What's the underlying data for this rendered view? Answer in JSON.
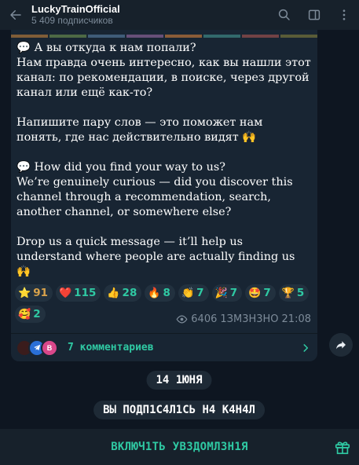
{
  "header": {
    "title": "LuckyTrainOfficial",
    "subtitle": "5 409 подписчиков",
    "icons": [
      "back-arrow-icon",
      "search-icon",
      "sidebar-toggle-icon",
      "more-vertical-icon"
    ]
  },
  "post": {
    "text": "💬 А вы откуда к нам попали?\nНам правда очень интересно, как вы нашли этот канал: по рекомендации, в поиске, через другой канал или ещё как-то?\n\nНапишите пару слов — это поможет нам понять, где нас действительно видят 🙌\n\n💬 How did you find your way to us?\nWe’re genuinely curious — did you discover this channel through a recommendation, search, another channel, or somewhere else?\n\nDrop us a quick message — it’ll help us understand where people are actually finding us 🙌",
    "reactions": [
      {
        "emoji": "⭐",
        "count": "91",
        "accent": "#d8a24b"
      },
      {
        "emoji": "❤️",
        "count": "115",
        "accent": "#2fc9a3"
      },
      {
        "emoji": "👍",
        "count": "28",
        "accent": "#2fc9a3"
      },
      {
        "emoji": "🔥",
        "count": "8",
        "accent": "#2fc9a3"
      },
      {
        "emoji": "👏",
        "count": "7",
        "accent": "#2fc9a3"
      },
      {
        "emoji": "🎉",
        "count": "7",
        "accent": "#2fc9a3"
      },
      {
        "emoji": "🤩",
        "count": "7",
        "accent": "#2fc9a3"
      },
      {
        "emoji": "🏆",
        "count": "5",
        "accent": "#2fc9a3"
      },
      {
        "emoji": "🥰",
        "count": "2",
        "accent": "#2fc9a3"
      }
    ],
    "views": "6406",
    "edited_label": "1ЗМ3Н3НО",
    "time": "21:08",
    "comments_label": "7 комментариев",
    "comment_avatar_letter": "B"
  },
  "date_separator": "14 1ЮНЯ",
  "status_message": "ВЫ ПОДП1С4Л1СЬ Н4 К4Н4Л",
  "bottom_action": "ВКЛЮЧ1ТЬ УВЗДОМЛ3Н1Я",
  "colors": {
    "background": "#0e1621",
    "header": "#17212b",
    "bubble": "#182533",
    "accent": "#2fc9a3"
  }
}
